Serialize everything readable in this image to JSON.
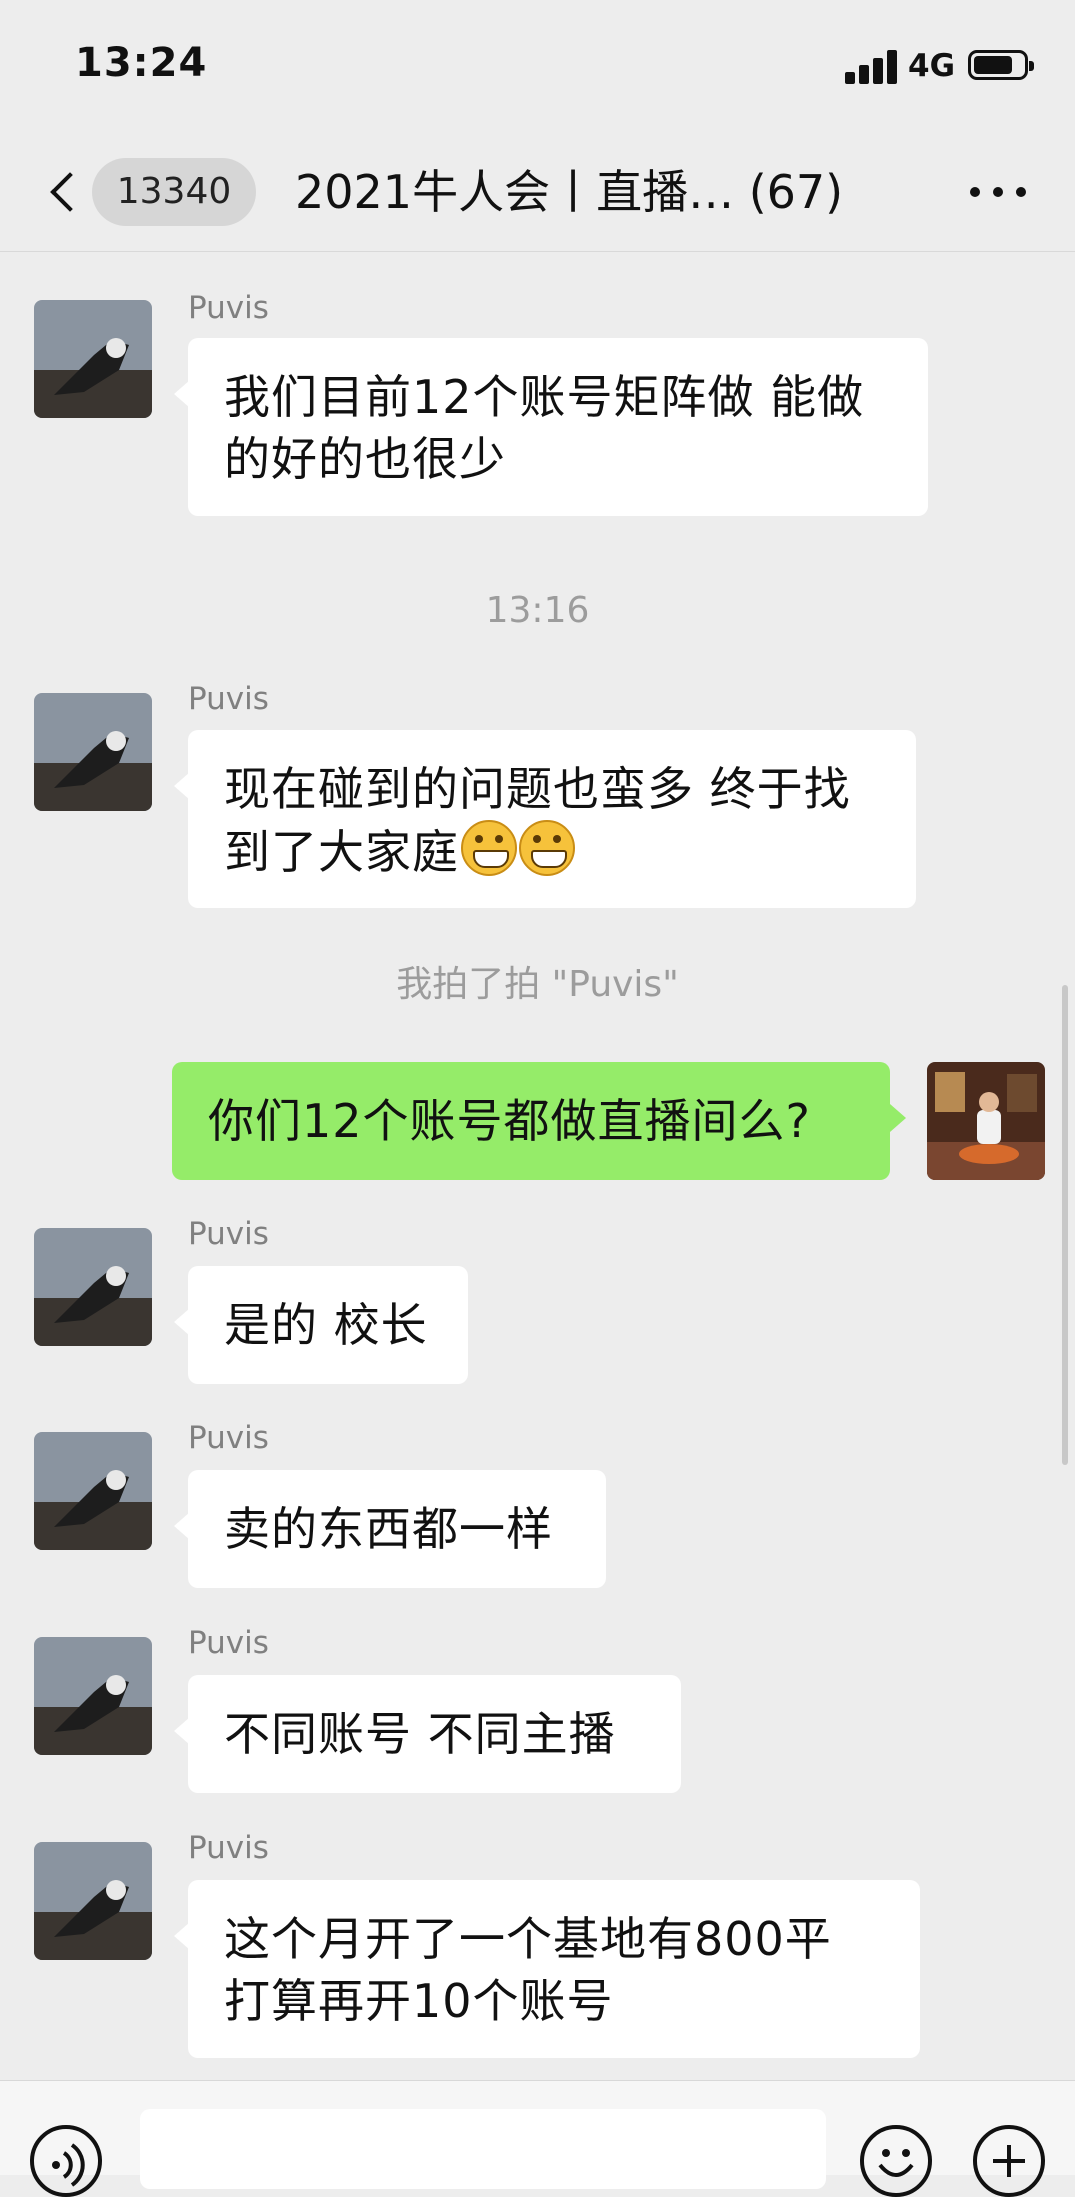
{
  "status": {
    "time": "13:24",
    "network": "4G"
  },
  "nav": {
    "unread_count": "13340",
    "title": "2021牛人会丨直播…  (67)"
  },
  "timestamps": [
    "13:16"
  ],
  "system": {
    "pat": "我拍了拍 \"Puvis\""
  },
  "messages": [
    {
      "sender": "Puvis",
      "line1": "我们目前12个账号矩阵做 能做",
      "line2": "的好的也很少"
    },
    {
      "sender": "Puvis",
      "line1": "现在碰到的问题也蛮多 终于找",
      "line2": "到了大家庭",
      "emoji": "grin-emoji"
    },
    {
      "sender": "",
      "text": "你们12个账号都做直播间么?"
    },
    {
      "sender": "Puvis",
      "text": "是的 校长"
    },
    {
      "sender": "Puvis",
      "text": "卖的东西都一样"
    },
    {
      "sender": "Puvis",
      "text": "不同账号 不同主播"
    },
    {
      "sender": "Puvis",
      "line1": "这个月开了一个基地有800平",
      "line2": "打算再开10个账号"
    }
  ],
  "colors": {
    "background": "#ededed",
    "bubble_self": "#95ec69",
    "bubble_other": "#ffffff"
  },
  "icons": [
    "back-chevron-icon",
    "more-icon",
    "voice-icon",
    "emoji-icon",
    "plus-icon"
  ]
}
